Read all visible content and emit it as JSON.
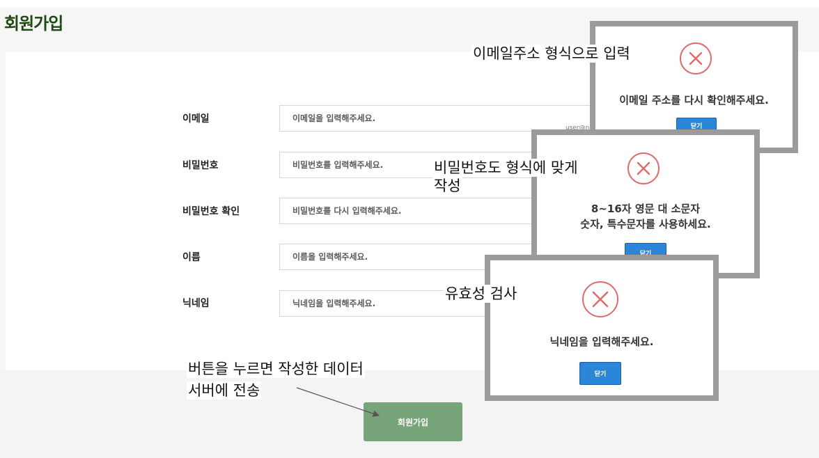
{
  "page": {
    "title": "회원가입"
  },
  "form": {
    "fields": [
      {
        "label": "이메일",
        "placeholder": "이메일을 입력해주세요."
      },
      {
        "label": "비밀번호",
        "placeholder": "비밀번호를 입력해주세요."
      },
      {
        "label": "비밀번호 확인",
        "placeholder": "비밀번호를 다시 입력해주세요."
      },
      {
        "label": "이름",
        "placeholder": "이름을 입력해주세요."
      },
      {
        "label": "닉네임",
        "placeholder": "닉네임을 입력해주세요."
      }
    ],
    "submit_label": "회원가입",
    "email_hint": "user@naver.com"
  },
  "modals": [
    {
      "message": "이메일 주소를 다시 확인해주세요.",
      "close_label": "닫기",
      "icon": "error-x-icon"
    },
    {
      "message_line1": "8~16자 영문 대 소문자",
      "message_line2": "숫자, 특수문자를 사용하세요.",
      "close_label": "닫기",
      "icon": "error-x-icon"
    },
    {
      "message": "닉네임을 입력해주세요.",
      "close_label": "닫기",
      "icon": "error-x-icon"
    }
  ],
  "annotations": {
    "email": "이메일주소 형식으로 입력",
    "password_line1": "비밀번호도 형식에 맞게",
    "password_line2": "작성",
    "validation": "유효성 검사",
    "submit_line1": "버튼을 누르면 작성한 데이터",
    "submit_line2": "서버에 전송"
  },
  "colors": {
    "title": "#1d4a12",
    "submit": "#78a47a",
    "modal_button": "#2b86d9",
    "error_icon": "#e06a6a"
  }
}
